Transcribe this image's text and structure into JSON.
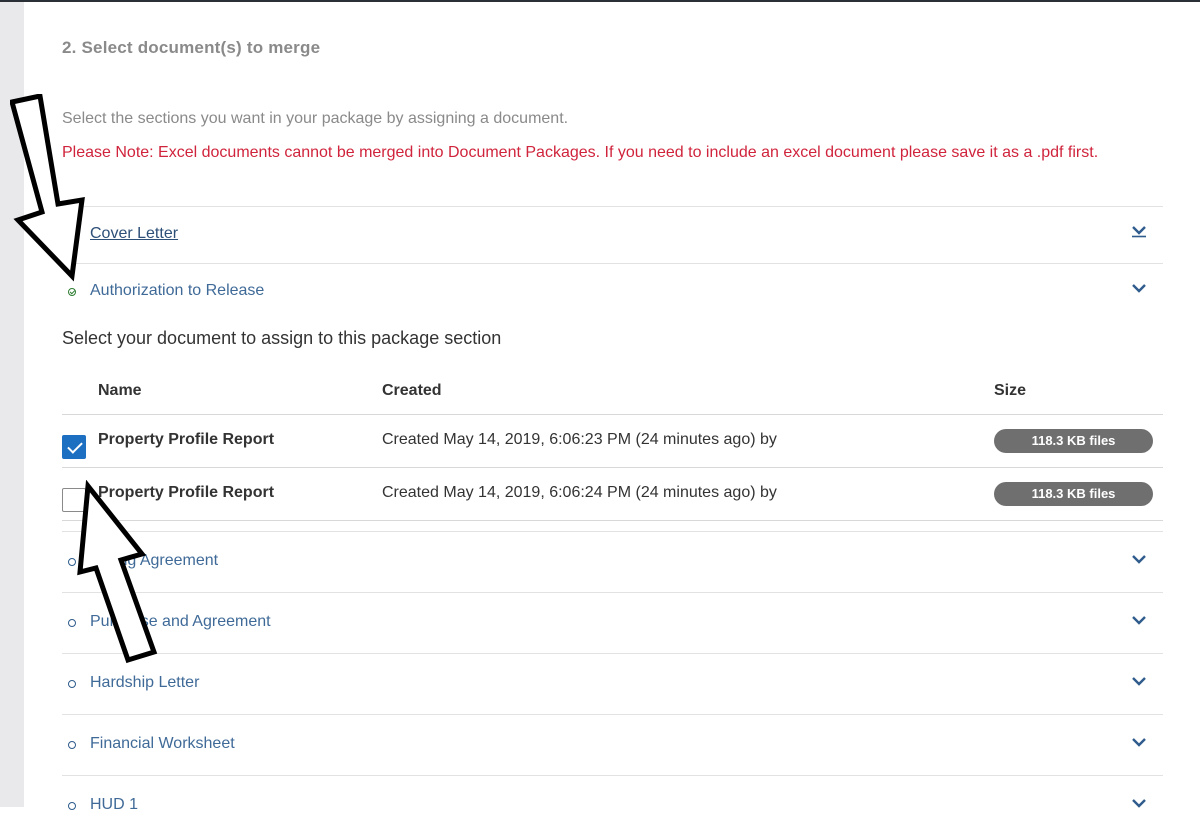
{
  "step": {
    "title": "2. Select document(s) to merge"
  },
  "intro_text": "Select the sections you want in your package by assigning a document.",
  "note_text": "Please Note: Excel documents cannot be merged into Document Packages. If you need to include an excel document please save it as a .pdf first.",
  "sections_top": [
    {
      "label": "Cover Letter",
      "status": "none"
    },
    {
      "label": "Authorization to Release",
      "status": "complete"
    }
  ],
  "assign_title": "Select your document to assign to this package section",
  "table": {
    "headers": {
      "name": "Name",
      "created": "Created",
      "size": "Size"
    },
    "rows": [
      {
        "checked": true,
        "name": "Property Profile Report",
        "created": "Created May 14, 2019, 6:06:23 PM (24 minutes ago) by",
        "size": "118.3 KB files"
      },
      {
        "checked": false,
        "name": "Property Profile Report",
        "created": "Created May 14, 2019, 6:06:24 PM (24 minutes ago) by",
        "size": "118.3 KB files"
      }
    ]
  },
  "sections_bottom": [
    {
      "label": "Listing Agreement",
      "status": "empty"
    },
    {
      "label": "Purchase and Agreement",
      "status": "empty"
    },
    {
      "label": "Hardship Letter",
      "status": "empty"
    },
    {
      "label": "Financial Worksheet",
      "status": "empty"
    },
    {
      "label": "HUD 1",
      "status": "empty"
    }
  ],
  "icons": {
    "expand": "chevron-down-icon",
    "incomplete": "circle-icon",
    "complete": "check-circle-icon",
    "pointer": "arrow-annotation"
  },
  "colors": {
    "link": "#3f6a98",
    "note": "#d0243c",
    "checkbox": "#1d6fc2",
    "badge": "#6f6f6f",
    "complete": "#2e7d32"
  }
}
